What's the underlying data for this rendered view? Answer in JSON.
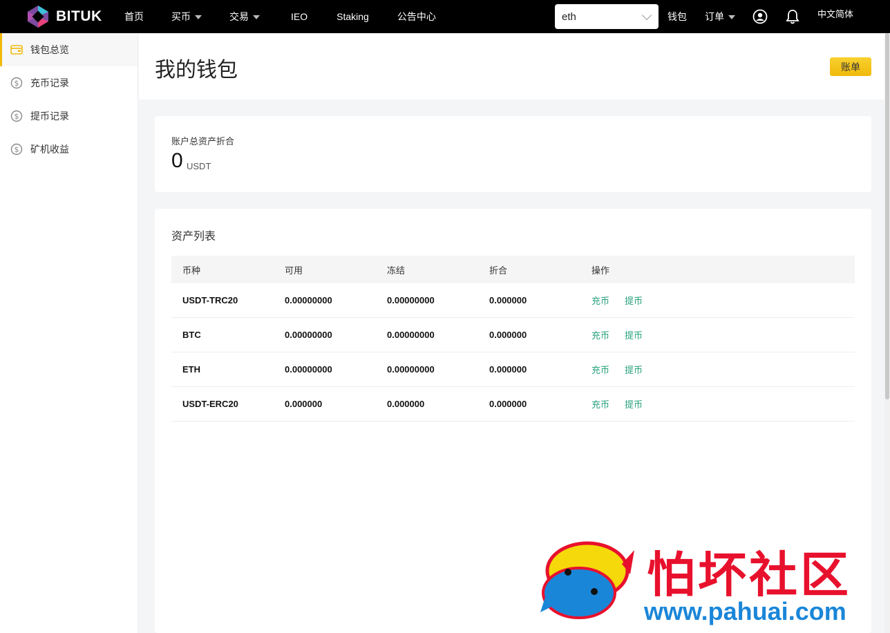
{
  "brand": {
    "name": "BITUK",
    "colors": {
      "accent": "#f0b90b",
      "green": "#26a17b"
    }
  },
  "nav": {
    "home": "首页",
    "buy": "买币",
    "trade": "交易",
    "ieo": "IEO",
    "staking": "Staking",
    "announcements": "公告中心"
  },
  "search": {
    "value": "eth"
  },
  "right_nav": {
    "wallet": "钱包",
    "orders": "订单",
    "language": "中文简体"
  },
  "sidebar": {
    "items": [
      {
        "label": "钱包总览",
        "icon": "wallet-icon",
        "active": true
      },
      {
        "label": "充币记录",
        "icon": "dollar-icon"
      },
      {
        "label": "提币记录",
        "icon": "dollar-icon"
      },
      {
        "label": "矿机收益",
        "icon": "dollar-icon"
      }
    ]
  },
  "page": {
    "title": "我的钱包",
    "bill_button": "账单"
  },
  "total": {
    "label": "账户总资产折合",
    "value": "0",
    "unit": "USDT"
  },
  "assets": {
    "title": "资产列表",
    "headers": [
      "币种",
      "可用",
      "冻结",
      "折合",
      "操作"
    ],
    "rows": [
      {
        "coin": "USDT-TRC20",
        "available": "0.00000000",
        "frozen": "0.00000000",
        "equiv": "0.000000"
      },
      {
        "coin": "BTC",
        "available": "0.00000000",
        "frozen": "0.00000000",
        "equiv": "0.000000"
      },
      {
        "coin": "ETH",
        "available": "0.00000000",
        "frozen": "0.00000000",
        "equiv": "0.000000"
      },
      {
        "coin": "USDT-ERC20",
        "available": "0.000000",
        "frozen": "0.000000",
        "equiv": "0.000000"
      }
    ],
    "deposit_label": "充币",
    "withdraw_label": "提币"
  },
  "watermark": {
    "cn": "怕坏社区",
    "url": "www.pahuai.com"
  }
}
